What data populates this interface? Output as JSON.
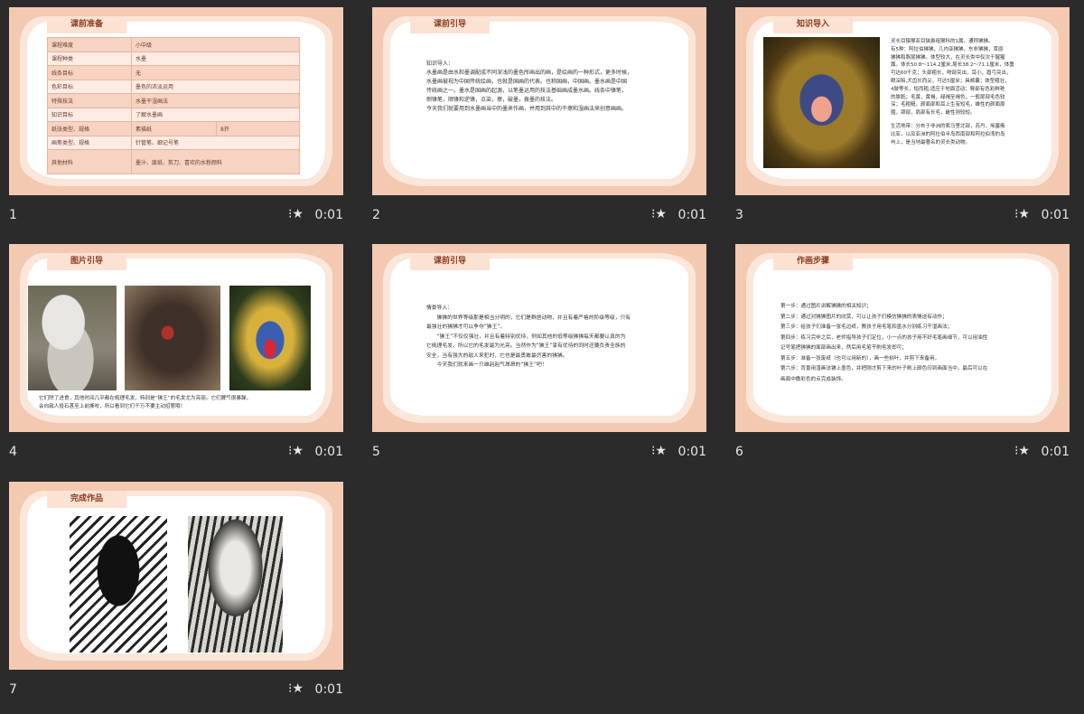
{
  "slides": [
    {
      "number": "1",
      "duration": "0:01",
      "title": "课前准备",
      "table": [
        [
          "课程难度",
          "小中级",
          ""
        ],
        [
          "课程种类",
          "水墨",
          ""
        ],
        [
          "线条目标",
          "无",
          ""
        ],
        [
          "色彩目标",
          "墨色的浓淡运用",
          ""
        ],
        [
          "特殊技法",
          "水墨干湿画法",
          ""
        ],
        [
          "知识目标",
          "了解水墨画",
          ""
        ],
        [
          "纸张类型、规格",
          "素描纸",
          "8开"
        ],
        [
          "画笔类型、规格",
          "针管笔、细记号笔",
          ""
        ],
        [
          "其他材料",
          "墨汁、废纸、剪刀、喜欢的水粉颜料",
          ""
        ]
      ]
    },
    {
      "number": "2",
      "duration": "0:01",
      "title": "课前引导",
      "lines": [
        "知识导入：",
        "水墨画是由水和墨调配成不同深浅的墨色所画出的画，是绘画的一种形式，更多时候，",
        "水墨画被视为中国传统绘画，也就是国画的代表。也称国画，中国画。墨水画是中国",
        "传统画之一。墨水是国画的起源，以笔墨运用的技法基础画成墨水画。线条中锋笔，",
        "侧锋笔，顺锋和逆锋，点染，擦，破墨，拨墨的技法。",
        "今天我们就要用到水墨画当中的墨来作画，并用到其中的干擦和湿画法来创意画画。"
      ]
    },
    {
      "number": "3",
      "duration": "0:01",
      "title": "知识导入",
      "lines": [
        "灵长目猿猴亚目狭鼻组猴科的1属，通称狒狒。",
        "有5种：阿拉伯狒狒，几内亚狒狒，东非狒狒，草原",
        "狒狒和豚尾狒狒。体型较大，在灵长类中仅次于猩猩",
        "属。体长50.8～114.2厘米,尾长38.2～71.1厘米，体重",
        "可达60千克；头部粗长，吻部突出，耳小，眉弓突出，",
        "眼深陷,犬齿长而尖，可达5厘米；具颊囊；体型粗壮，",
        "4肢等长，短而粗,适应于地面活动；臀部有色彩鲜艳",
        "的胼胝；毛黄，黄褐，绿褐至褐色，一般尾部毛色较",
        "深；毛粗糙，颜面部和耳上生有短毛，雄性的颜面周",
        "围，颈部，肩部有长毛，雌性则较短。",
        "",
        "生活地带：分布于非洲的索马里北部，苏丹，埃塞俄",
        "比亚，以及亚洲的阿拉伯半岛西南部和阿拉伯湾的岛",
        "屿上，是当地最著名的灵长类动物。"
      ]
    },
    {
      "number": "4",
      "duration": "0:01",
      "title": "图片引导",
      "lines": [
        "它们除了进食，其他时间几乎都在梳理毛发，特别是“狒王”的毛发尤为亮丽。它们脾气很暴躁，",
        "会向敌人投石甚至上前撕咬，所以看到它们千万不要主动招惹哦！"
      ]
    },
    {
      "number": "5",
      "duration": "0:01",
      "title": "课前引导",
      "lines": [
        "情景导入：",
        "　　狒狒的世界等级那是相当分明的，它们是群居动物，并且有着严格的阶级等级，只有",
        "最强壮的狒狒才可以争夺“狒王”。",
        "　　“狒王”不仅仅强壮，并且有着特别优待，例如其他的低等级狒狒每天都要认真的为",
        "它梳理毛发，所以它的毛发最为光亮。当然作为“狒王”享有优待的同时还要负责全族的",
        "安全，当有强大的敌人来犯时，它也是最勇敢最厉害的狒狒。",
        "　　今天我们就来画一只雄赳赳气昂昂的“狒王”吧！"
      ]
    },
    {
      "number": "6",
      "duration": "0:01",
      "title": "作画步骤",
      "lines": [
        "第一步：通过图片讲解狒狒的相关知识；",
        "第二步：通过对狒狒图片的欣赏，可以让孩子们模仿狒狒的表情送有动作；",
        "第三步：给孩子们准备一张毛边纸，教孩子用毛笔和墨水分别练习干湿画法；",
        "第四步：练习完毕之后，老师指导孩子们定位，小一点的孩子用不好毛笔画细节，可以用油性",
        "记号笔把狒狒的面部画出来，然后用毛笔干刷毛发即可；",
        "第五步：准备一张废纸（也可以用新的），画一些树叶，并剪下来备用。",
        "第六步：背景用湿画法铺上墨色，并把刚才剪下来的叶子刷上颜色印到画面当中，最后可以在",
        "画面中撒彩色的点完成装饰。"
      ]
    },
    {
      "number": "7",
      "duration": "0:01",
      "title": "完成作品"
    }
  ],
  "icons": {
    "play": "play-star-icon"
  }
}
